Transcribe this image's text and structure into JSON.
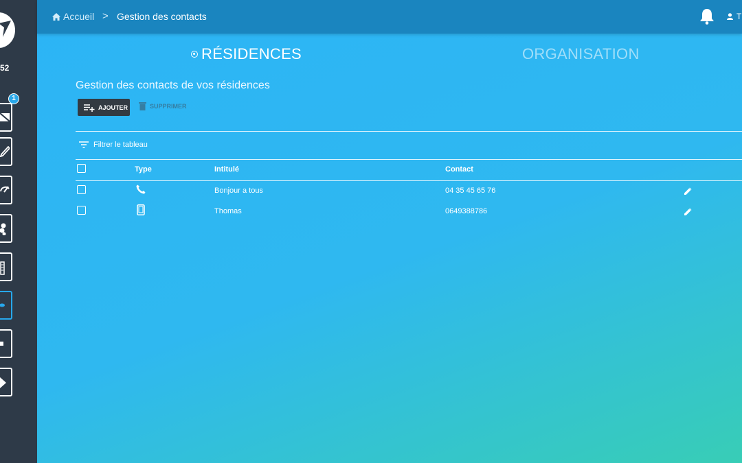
{
  "sidebar": {
    "number": "52",
    "badge": "1"
  },
  "header": {
    "home_label": "Accueil",
    "separator": ">",
    "current_label": "Gestion des contacts",
    "user_label": "T"
  },
  "tabs": [
    {
      "label": "RÉSIDENCES",
      "active": true
    },
    {
      "label": "ORGANISATION",
      "active": false
    }
  ],
  "main": {
    "subtitle": "Gestion des contacts de vos résidences",
    "add_label": "AJOUTER",
    "delete_label": "SUPPRIMER",
    "filter_label": "Filtrer le tableau"
  },
  "table": {
    "columns": [
      "Type",
      "Intitulé",
      "Contact"
    ],
    "rows": [
      {
        "type_icon": "phone-icon",
        "title": "Bonjour a tous",
        "contact": "04 35 45 65 76"
      },
      {
        "type_icon": "mobile-icon",
        "title": "Thomas",
        "contact": "0649388786"
      }
    ]
  }
}
